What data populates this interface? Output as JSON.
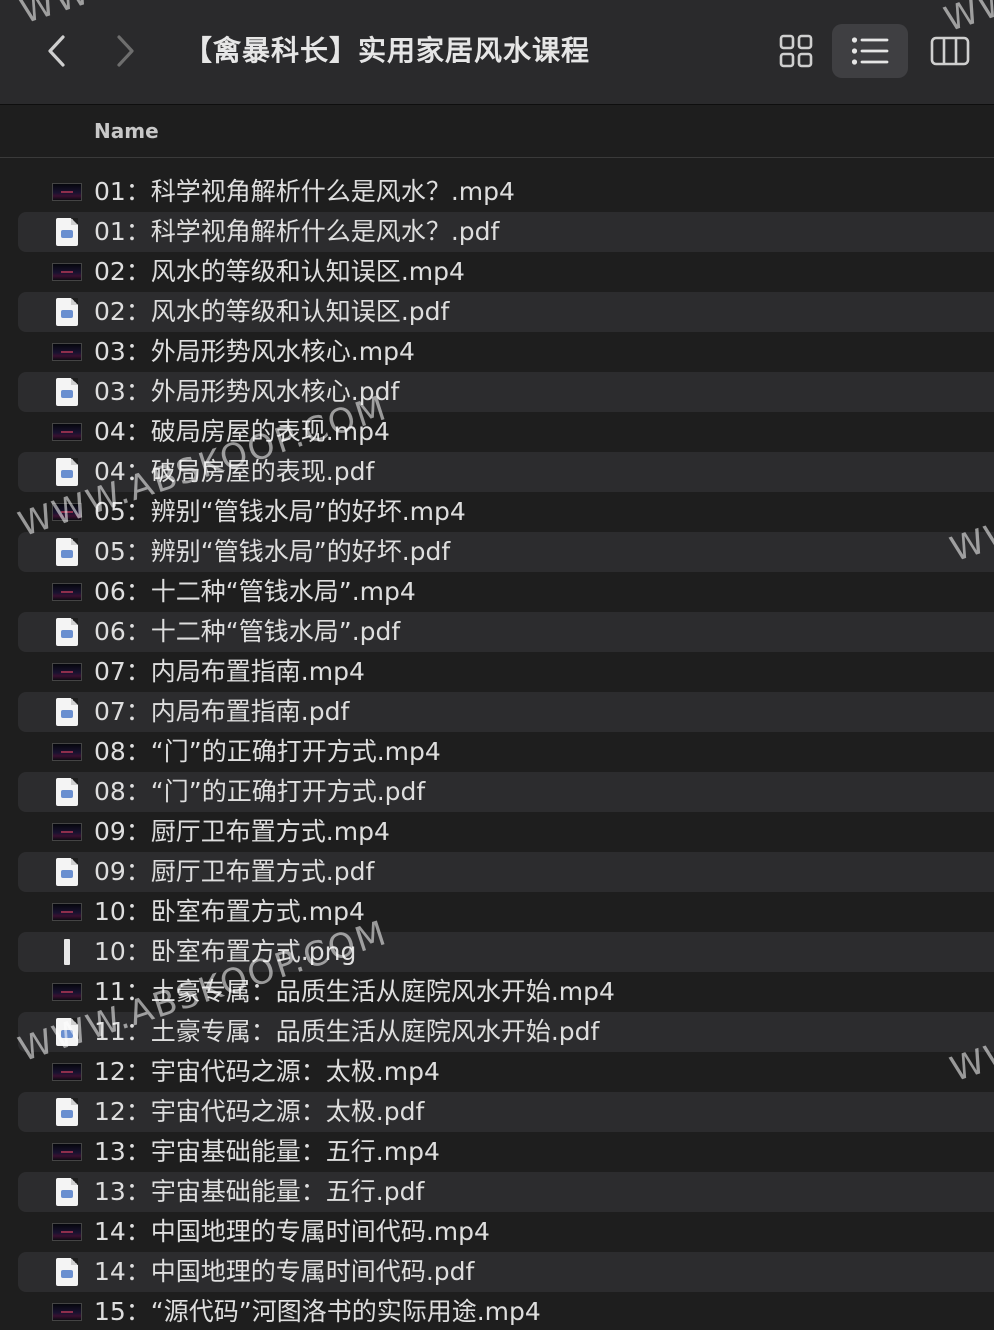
{
  "window": {
    "title": "【禽暴科长】实用家居风水课程"
  },
  "toolbar": {
    "back_icon": "chevron-left-icon",
    "forward_icon": "chevron-right-icon",
    "view_modes": [
      "icon-grid-view",
      "list-view",
      "column-view"
    ],
    "active_view": "list-view"
  },
  "columns": {
    "name": "Name"
  },
  "files": [
    {
      "name": "01：科学视角解析什么是风水？.mp4",
      "kind": "video"
    },
    {
      "name": "01：科学视角解析什么是风水？.pdf",
      "kind": "pdf"
    },
    {
      "name": "02：风水的等级和认知误区.mp4",
      "kind": "video"
    },
    {
      "name": "02：风水的等级和认知误区.pdf",
      "kind": "pdf"
    },
    {
      "name": "03：外局形势风水核心.mp4",
      "kind": "video"
    },
    {
      "name": "03：外局形势风水核心.pdf",
      "kind": "pdf"
    },
    {
      "name": "04：破局房屋的表现.mp4",
      "kind": "video"
    },
    {
      "name": "04：破局房屋的表现.pdf",
      "kind": "pdf"
    },
    {
      "name": "05：辨别“管钱水局”的好坏.mp4",
      "kind": "video"
    },
    {
      "name": "05：辨别“管钱水局”的好坏.pdf",
      "kind": "pdf"
    },
    {
      "name": "06：十二种“管钱水局”.mp4",
      "kind": "video"
    },
    {
      "name": "06：十二种“管钱水局”.pdf",
      "kind": "pdf"
    },
    {
      "name": "07：内局布置指南.mp4",
      "kind": "video"
    },
    {
      "name": "07：内局布置指南.pdf",
      "kind": "pdf"
    },
    {
      "name": "08：“门”的正确打开方式.mp4",
      "kind": "video"
    },
    {
      "name": "08：“门”的正确打开方式.pdf",
      "kind": "pdf"
    },
    {
      "name": "09：厨厅卫布置方式.mp4",
      "kind": "video"
    },
    {
      "name": "09：厨厅卫布置方式.pdf",
      "kind": "pdf"
    },
    {
      "name": "10：卧室布置方式.mp4",
      "kind": "video"
    },
    {
      "name": "10：卧室布置方式.png",
      "kind": "png"
    },
    {
      "name": "11：土豪专属：品质生活从庭院风水开始.mp4",
      "kind": "video"
    },
    {
      "name": "11：土豪专属：品质生活从庭院风水开始.pdf",
      "kind": "pdf"
    },
    {
      "name": "12：宇宙代码之源：太极.mp4",
      "kind": "video"
    },
    {
      "name": "12：宇宙代码之源：太极.pdf",
      "kind": "pdf"
    },
    {
      "name": "13：宇宙基础能量：五行.mp4",
      "kind": "video"
    },
    {
      "name": "13：宇宙基础能量：五行.pdf",
      "kind": "pdf"
    },
    {
      "name": "14：中国地理的专属时间代码.mp4",
      "kind": "video"
    },
    {
      "name": "14：中国地理的专属时间代码.pdf",
      "kind": "pdf"
    },
    {
      "name": "15：“源代码”河图洛书的实际用途.mp4",
      "kind": "video"
    }
  ],
  "watermark": {
    "text": "WWW.ABSKOOP.COM",
    "edge_text": "WW"
  },
  "colors": {
    "toolbar_bg": "#2a2a2c",
    "window_bg": "#1e1e1e",
    "alt_row_bg": "#2c2c2e",
    "text": "#dedede",
    "active_view_bg": "#3f3f42"
  }
}
